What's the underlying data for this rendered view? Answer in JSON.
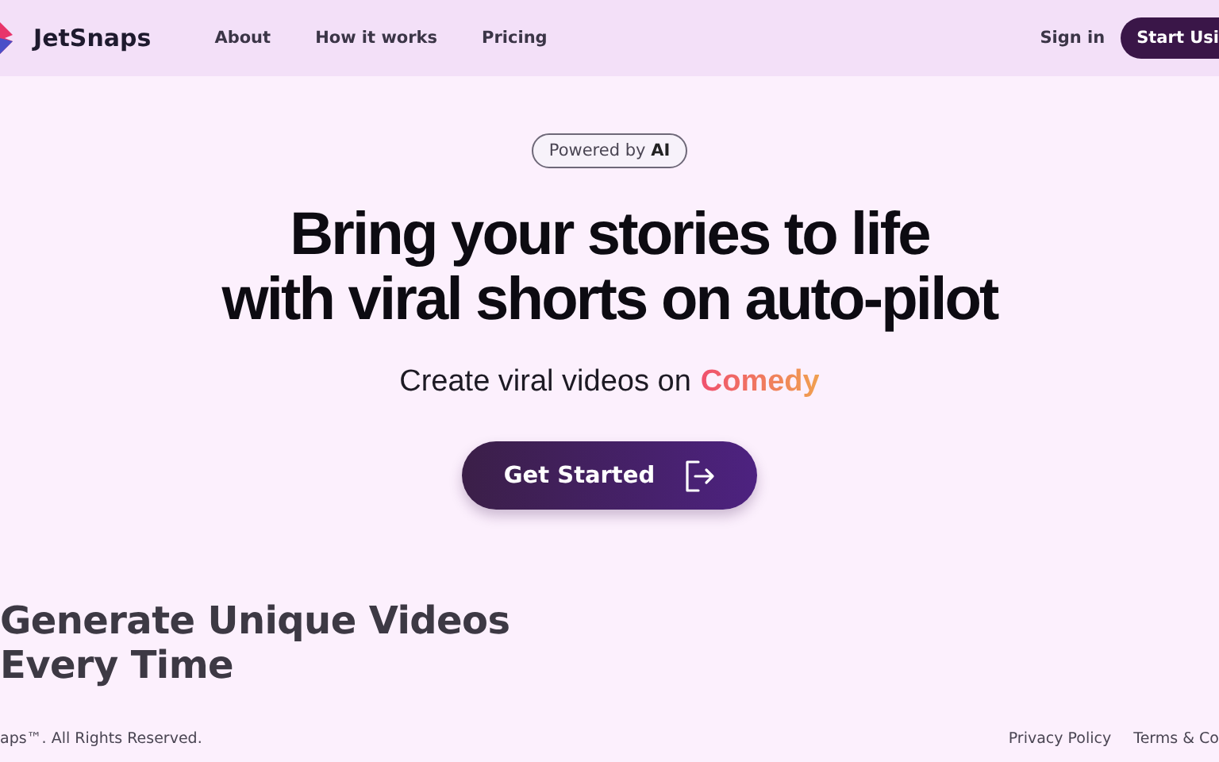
{
  "navbar": {
    "brand": "JetSnaps",
    "links": [
      "About",
      "How it works",
      "Pricing"
    ],
    "sign_in": "Sign in",
    "cta": "Start Usi"
  },
  "hero": {
    "badge": "Powered by **AI**",
    "headline": [
      "Bring your stories to life",
      "with viral shorts on auto-pilot"
    ],
    "subtitle": "Create viral videos on",
    "highlight": "Comedy",
    "button": "Get Started"
  },
  "section": {
    "heading": [
      "Generate Unique Videos",
      "Every Time"
    ]
  },
  "footer": {
    "copyright": "aps™. All Rights Reserved.",
    "links": [
      "Privacy Policy",
      "Terms & Co"
    ]
  }
}
